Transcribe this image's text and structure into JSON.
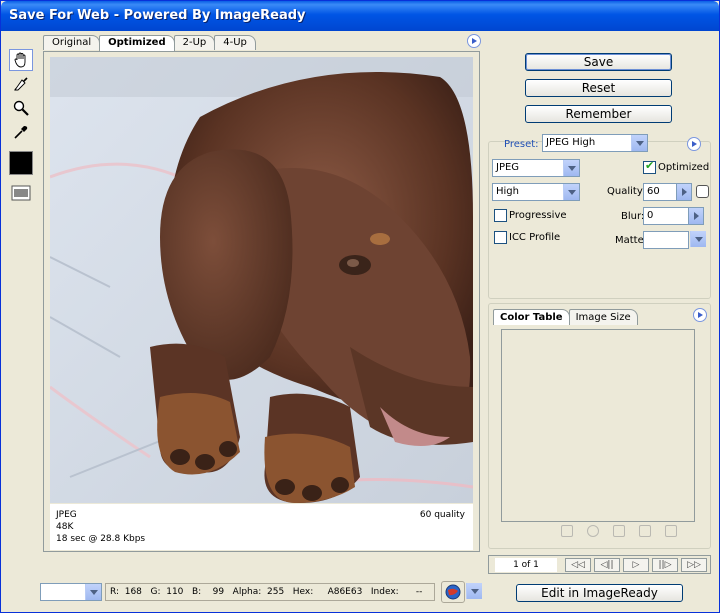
{
  "window": {
    "title": "Save For Web - Powered By ImageReady",
    "close_label": "×"
  },
  "tabs": [
    {
      "label": "Original"
    },
    {
      "label": "Optimized"
    },
    {
      "label": "2-Up"
    },
    {
      "label": "4-Up"
    }
  ],
  "image_info": {
    "format": "JPEG",
    "size": "48K",
    "time": "18 sec @ 28.8 Kbps",
    "quality": "60 quality"
  },
  "buttons": {
    "save": "Save",
    "reset": "Reset",
    "remember": "Remember",
    "edit": "Edit in ImageReady"
  },
  "settings": {
    "preset_label": "Preset:",
    "preset_value": "JPEG High",
    "format_value": "JPEG",
    "quality_preset_value": "High",
    "optimized_label": "Optimized",
    "quality_label": "Quality:",
    "quality_value": "60",
    "progressive_label": "Progressive",
    "blur_label": "Blur:",
    "blur_value": "0",
    "icc_label": "ICC Profile",
    "matte_label": "Matte:"
  },
  "color_tabs": [
    {
      "label": "Color Table"
    },
    {
      "label": "Image Size"
    }
  ],
  "navigation": {
    "count": "1 of 1",
    "buttons": [
      "◁◁",
      "◁||",
      "▷",
      "||▷",
      "▷▷"
    ]
  },
  "status": {
    "text": "R:  168   G:  110   B:    99   Alpha:  255   Hex:     A86E63   Index:      --"
  },
  "colors": {
    "titlebar": "#0055E5",
    "background": "#ECE9D8",
    "accent": "#1F4FB4"
  }
}
